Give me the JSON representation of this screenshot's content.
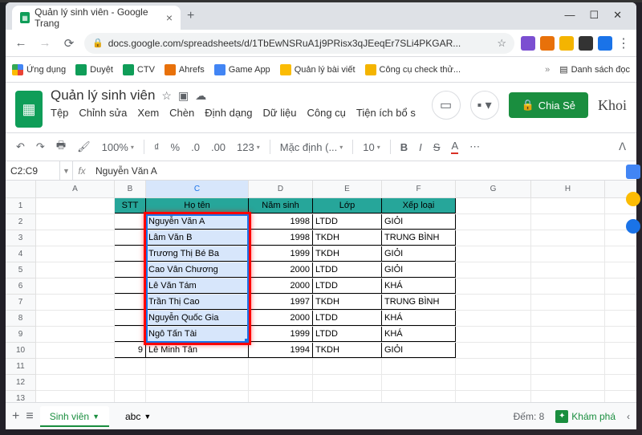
{
  "tab": {
    "title": "Quản lý sinh viên - Google Trang"
  },
  "url": "docs.google.com/spreadsheets/d/1TbEwNSRuA1j9PRisx3qJEeqEr7SLi4PKGAR...",
  "bookmarks": {
    "apps": "Ứng dụng",
    "items": [
      "Duyệt",
      "CTV",
      "Ahrefs",
      "Game App",
      "Quản lý bài viết",
      "Công cụ check thử..."
    ],
    "reading": "Danh sách đọc"
  },
  "doc": {
    "title": "Quản lý sinh viên",
    "menus": [
      "Tệp",
      "Chỉnh sửa",
      "Xem",
      "Chèn",
      "Định dạng",
      "Dữ liệu",
      "Công cụ",
      "Tiện ích bổ s"
    ],
    "share": "Chia Sẻ",
    "avatar": "Khoi"
  },
  "toolbar": {
    "zoom": "100%",
    "currency": "₫",
    "percent": "%",
    "dec0": ".0",
    "dec00": ".00",
    "fmt": "123",
    "font": "Mặc định (...",
    "size": "10"
  },
  "namebox": {
    "ref": "C2:C9",
    "value": "Nguyễn Văn A"
  },
  "cols": [
    "A",
    "B",
    "C",
    "D",
    "E",
    "F",
    "G",
    "H"
  ],
  "headers": {
    "stt": "STT",
    "hoten": "Họ tên",
    "nam": "Năm sinh",
    "lop": "Lớp",
    "xl": "Xếp loại"
  },
  "rows": [
    {
      "stt": "",
      "name": "Nguyễn Văn A",
      "year": "1998",
      "class": "LTDD",
      "grade": "GIỎI"
    },
    {
      "stt": "",
      "name": "Lâm Văn B",
      "year": "1998",
      "class": "TKDH",
      "grade": "TRUNG BÌNH"
    },
    {
      "stt": "",
      "name": "Trương Thị Bé Ba",
      "year": "1999",
      "class": "TKDH",
      "grade": "GIỎI"
    },
    {
      "stt": "",
      "name": "Cao Vân Chương",
      "year": "2000",
      "class": "LTDD",
      "grade": "GIỎI"
    },
    {
      "stt": "",
      "name": "Lê Văn Tám",
      "year": "2000",
      "class": "LTDD",
      "grade": "KHÁ"
    },
    {
      "stt": "",
      "name": "Trần Thị Cao",
      "year": "1997",
      "class": "TKDH",
      "grade": "TRUNG BÌNH"
    },
    {
      "stt": "",
      "name": "Nguyễn Quốc Gia",
      "year": "2000",
      "class": "LTDD",
      "grade": "KHÁ"
    },
    {
      "stt": "",
      "name": "Ngô Tấn Tài",
      "year": "1999",
      "class": "LTDD",
      "grade": "KHÁ"
    },
    {
      "stt": "9",
      "name": "Lê Minh Tân",
      "year": "1994",
      "class": "TKDH",
      "grade": "GIỎI"
    }
  ],
  "tabs": {
    "active": "Sinh viên",
    "other": "abc"
  },
  "footer": {
    "count": "Đếm: 8",
    "explore": "Khám phá"
  }
}
